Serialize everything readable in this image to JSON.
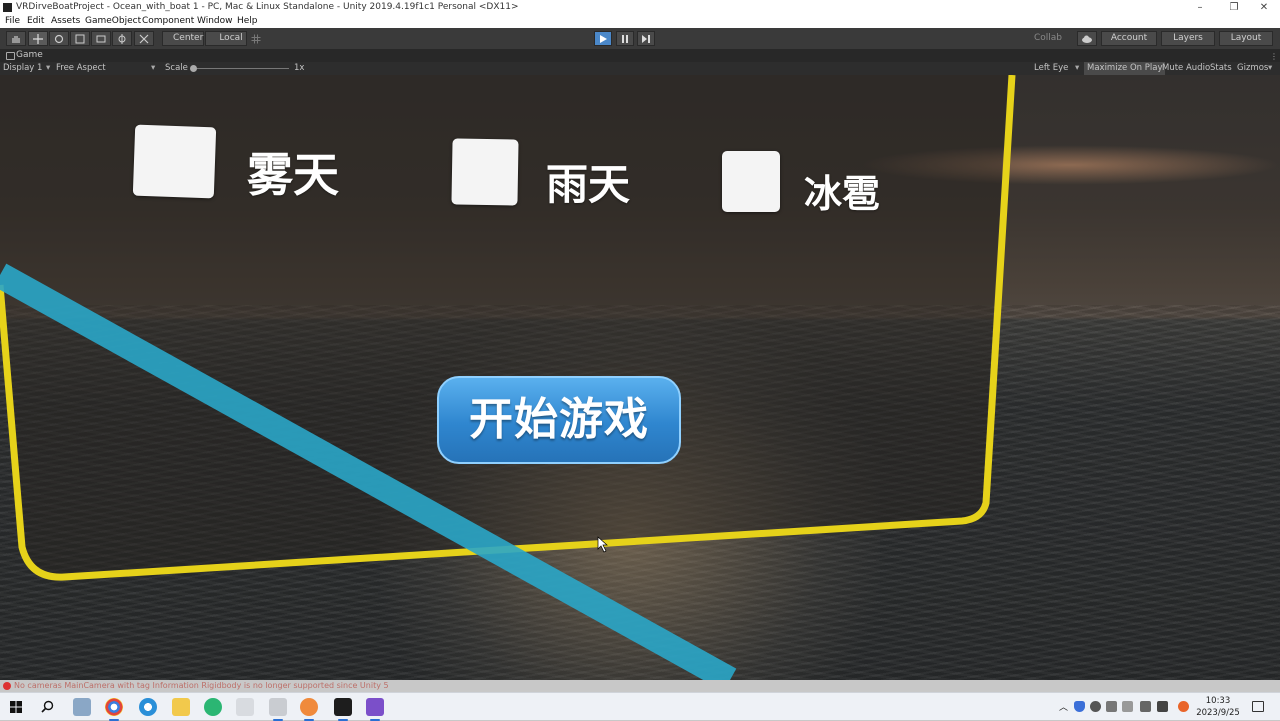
{
  "window": {
    "title": "VRDirveBoatProject - Ocean_with_boat 1 - PC, Mac & Linux Standalone - Unity 2019.4.19f1c1 Personal <DX11>",
    "controls": [
      "–",
      "❐",
      "✕"
    ]
  },
  "menu": [
    "File",
    "Edit",
    "Assets",
    "GameObject",
    "Component",
    "Window",
    "Help"
  ],
  "toolbar": {
    "pivot_label": "Center",
    "space_label": "Local",
    "collab_label": "Collab",
    "account_label": "Account",
    "layers_label": "Layers",
    "layout_label": "Layout"
  },
  "game_tab": {
    "label": "Game"
  },
  "game_toolbar": {
    "display": "Display 1",
    "aspect": "Free Aspect",
    "scale_label": "Scale",
    "scale_value": "1x",
    "eye": "Left Eye",
    "maximize": "Maximize On Play",
    "mute": "Mute Audio",
    "stats": "Stats",
    "gizmos": "Gizmos"
  },
  "scene": {
    "options": [
      {
        "label": "雾天"
      },
      {
        "label": "雨天"
      },
      {
        "label": "冰雹"
      }
    ],
    "start_button": "开始游戏",
    "colors": {
      "frame": "#e6d21a",
      "beam": "#2aa6c8",
      "button": "#2f86cf"
    }
  },
  "status": {
    "message": "No cameras MainCamera with tag Information Rigidbody is no longer supported since Unity 5"
  },
  "taskbar": {
    "time": "10:33",
    "date": "2023/9/25"
  }
}
